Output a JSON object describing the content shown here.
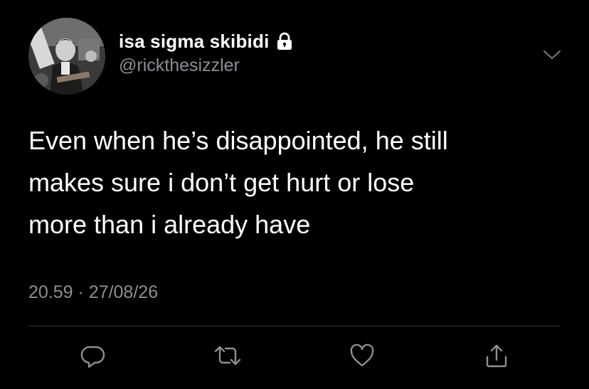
{
  "user": {
    "display_name": "isa sigma skibidi",
    "handle": "@rickthesizzler",
    "protected_icon": "lock-icon",
    "avatar": "profile-photo"
  },
  "tweet": {
    "text": "Even when he’s disappointed, he still\nmakes sure i don’t get hurt or lose\nmore than i already have",
    "timestamp": "20.59 · 27/08/26"
  },
  "actions": [
    {
      "name": "reply",
      "icon": "reply-icon"
    },
    {
      "name": "retweet",
      "icon": "retweet-icon"
    },
    {
      "name": "like",
      "icon": "heart-icon"
    },
    {
      "name": "share",
      "icon": "share-icon"
    }
  ],
  "colors": {
    "background": "#000000",
    "text_primary": "#ffffff",
    "text_secondary": "#8b8f94",
    "divider": "#2f3336",
    "icon": "#8b8f94"
  }
}
